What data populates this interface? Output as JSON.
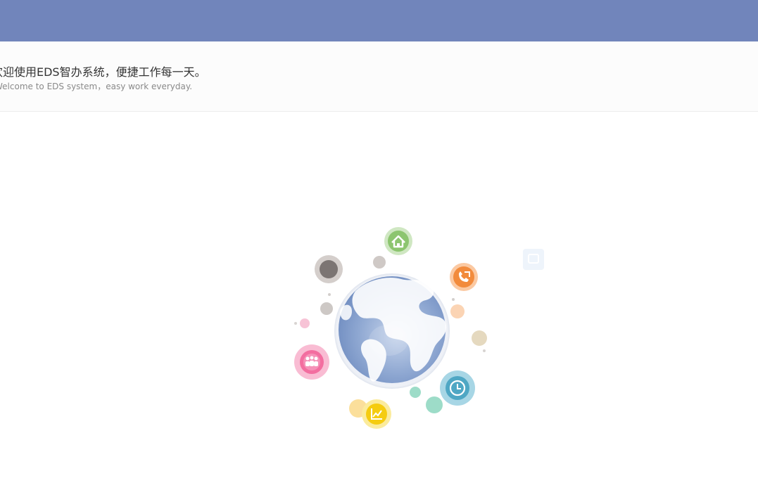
{
  "header": {
    "bar_color": "#7185bb"
  },
  "welcome": {
    "title_cn": "欢迎使用EDS智办系统，便捷工作每一天。",
    "subtitle_en": "Welcome to EDS  system，easy work everyday."
  },
  "illustration": {
    "icons": [
      "home-icon",
      "phone-icon",
      "team-icon",
      "chart-icon",
      "clock-icon",
      "record-icon",
      "chat-icon"
    ],
    "colors": {
      "home": "#8cc56f",
      "phone": "#f28b3c",
      "team": "#f36ea0",
      "chart": "#f5cc10",
      "clock": "#4fa7c4",
      "record": "#8e8683",
      "globe": "#7f9ccb"
    }
  }
}
